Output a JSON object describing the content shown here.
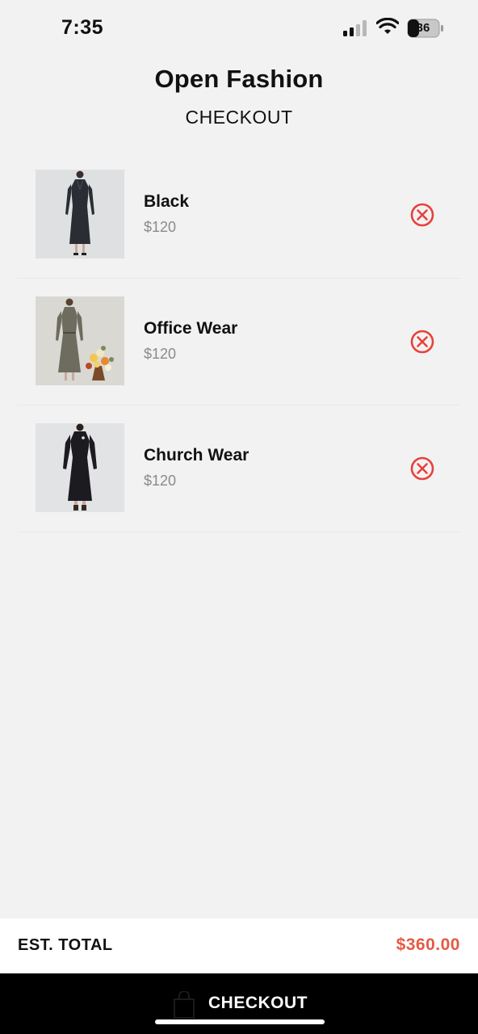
{
  "status_bar": {
    "time": "7:35",
    "battery": "36",
    "icons": [
      "signal-icon",
      "wifi-icon",
      "battery-icon"
    ]
  },
  "header": {
    "title": "Open Fashion",
    "subtitle": "CHECKOUT"
  },
  "cart": {
    "items": [
      {
        "name": "Black",
        "price": "$120",
        "image": "black-coat-dress-photo"
      },
      {
        "name": "Office Wear",
        "price": "$120",
        "image": "olive-office-dress-photo"
      },
      {
        "name": "Church Wear",
        "price": "$120",
        "image": "black-church-dress-photo"
      }
    ],
    "remove_icon": "close-circle-icon"
  },
  "summary": {
    "total_label": "EST. TOTAL",
    "total_value": "$360.00"
  },
  "checkout": {
    "label": "CHECKOUT",
    "icon": "shopping-bag-icon"
  },
  "colors": {
    "background": "#f2f2f2",
    "accent": "#e55a44",
    "remove_icon": "#e8413b",
    "checkout_bg": "#000000"
  }
}
